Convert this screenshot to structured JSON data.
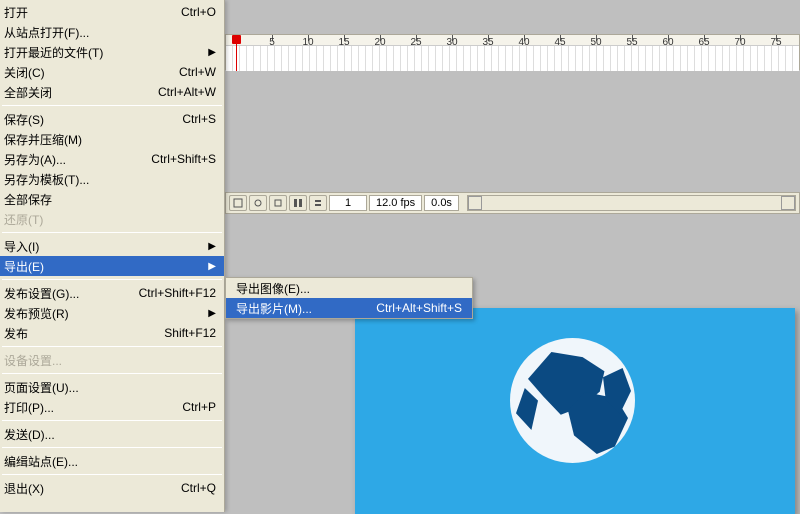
{
  "menu": {
    "open": "打开",
    "open_sc": "Ctrl+O",
    "open_site": "从站点打开(F)...",
    "open_recent": "打开最近的文件(T)",
    "close": "关闭(C)",
    "close_sc": "Ctrl+W",
    "close_all": "全部关闭",
    "close_all_sc": "Ctrl+Alt+W",
    "save": "保存(S)",
    "save_sc": "Ctrl+S",
    "save_compact": "保存并压缩(M)",
    "save_as": "另存为(A)...",
    "save_as_sc": "Ctrl+Shift+S",
    "save_as_tpl": "另存为模板(T)...",
    "save_all": "全部保存",
    "revert": "还原(T)",
    "import": "导入(I)",
    "export": "导出(E)",
    "publish_settings": "发布设置(G)...",
    "publish_settings_sc": "Ctrl+Shift+F12",
    "publish_preview": "发布预览(R)",
    "publish": "发布",
    "publish_sc": "Shift+F12",
    "device_settings": "设备设置...",
    "page_setup": "页面设置(U)...",
    "print": "打印(P)...",
    "print_sc": "Ctrl+P",
    "send": "发送(D)...",
    "edit_site": "编缉站点(E)...",
    "exit": "退出(X)",
    "exit_sc": "Ctrl+Q"
  },
  "submenu": {
    "export_image": "导出图像(E)...",
    "export_movie": "导出影片(M)...",
    "export_movie_sc": "Ctrl+Alt+Shift+S"
  },
  "ruler": {
    "ticks": [
      "5",
      "10",
      "15",
      "20",
      "25",
      "30",
      "35",
      "40",
      "45",
      "50",
      "55",
      "60",
      "65",
      "70",
      "75"
    ]
  },
  "status": {
    "frame": "1",
    "fps": "12.0 fps",
    "time": "0.0s"
  }
}
